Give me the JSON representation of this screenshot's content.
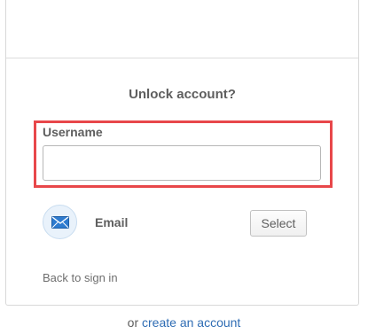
{
  "card": {
    "title": "Unlock account?"
  },
  "username": {
    "label": "Username",
    "value": "",
    "placeholder": ""
  },
  "factors": [
    {
      "label": "Email",
      "icon": "envelope-icon",
      "button_label": "Select"
    }
  ],
  "links": {
    "back": "Back to sign in"
  },
  "footer": {
    "prefix": "or",
    "link": "create an account"
  },
  "colors": {
    "highlight": "#e8474a",
    "link": "#2f6db4",
    "icon_blue": "#2e7bcf"
  }
}
